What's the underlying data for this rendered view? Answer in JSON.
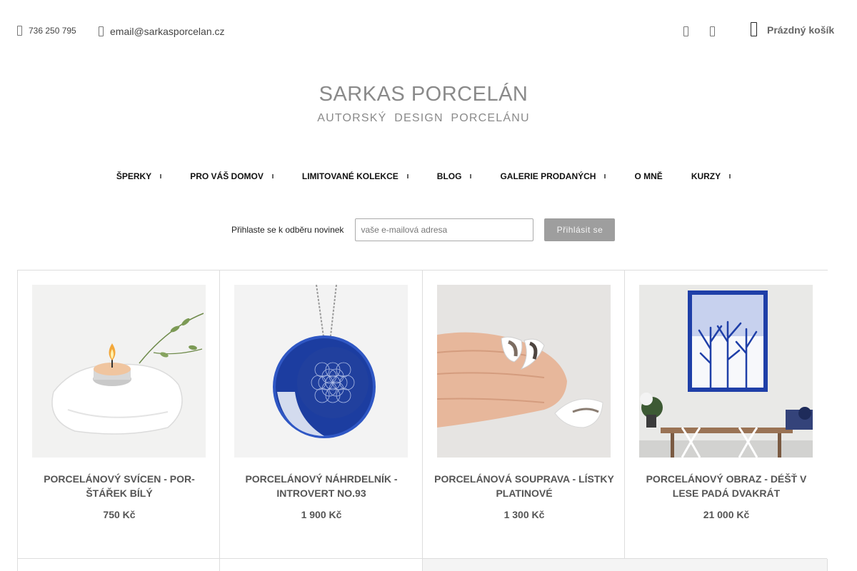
{
  "topbar": {
    "phone": "736 250 795",
    "email": "email@sarkasporcelan.cz",
    "cart_label": "Prázdný košík",
    "icons": [
      "phone-icon",
      "email-icon",
      "search-icon",
      "user-icon",
      "cart-icon"
    ]
  },
  "logo": {
    "title": "SARKAS PORCELÁN",
    "subtitle": "AUTORSKÝ DESIGN PORCELÁNU"
  },
  "nav": {
    "items": [
      {
        "label": "ŠPERKY",
        "has_submenu": true
      },
      {
        "label": "PRO VÁŠ DOMOV",
        "has_submenu": true
      },
      {
        "label": "LIMITOVANÉ KOLEKCE",
        "has_submenu": true
      },
      {
        "label": "BLOG",
        "has_submenu": true
      },
      {
        "label": "GALERIE PRODANÝCH",
        "has_submenu": true
      },
      {
        "label": "O MNĚ",
        "has_submenu": false
      },
      {
        "label": "KURZY",
        "has_submenu": true
      }
    ]
  },
  "newsletter": {
    "label": "Přihlaste se k odběru novinek",
    "placeholder": "vaše e-mailová adresa",
    "button": "Přihlásit se"
  },
  "products": [
    {
      "name": "PORCELÁNOVÝ SVÍCEN - POR-ŠTÁŘEK BÍLÝ",
      "price": "750 Kč"
    },
    {
      "name": "PORCELÁNOVÝ NÁHRDELNÍK - INTROVERT NO.93",
      "price": "1 900 Kč"
    },
    {
      "name": "PORCELÁNOVÁ SOUPRAVA - LÍSTKY PLATINOVÉ",
      "price": "1 300 Kč"
    },
    {
      "name": "PORCELÁNOVÝ OBRAZ - DÉŠŤ V LESE PADÁ DVAKRÁT",
      "price": "21 000 Kč"
    }
  ],
  "colors": {
    "logo_grey": "#8a8a8a",
    "button_grey": "#9e9e9e",
    "porcelain_blue": "#1f3fa8",
    "border": "#dddddd"
  }
}
